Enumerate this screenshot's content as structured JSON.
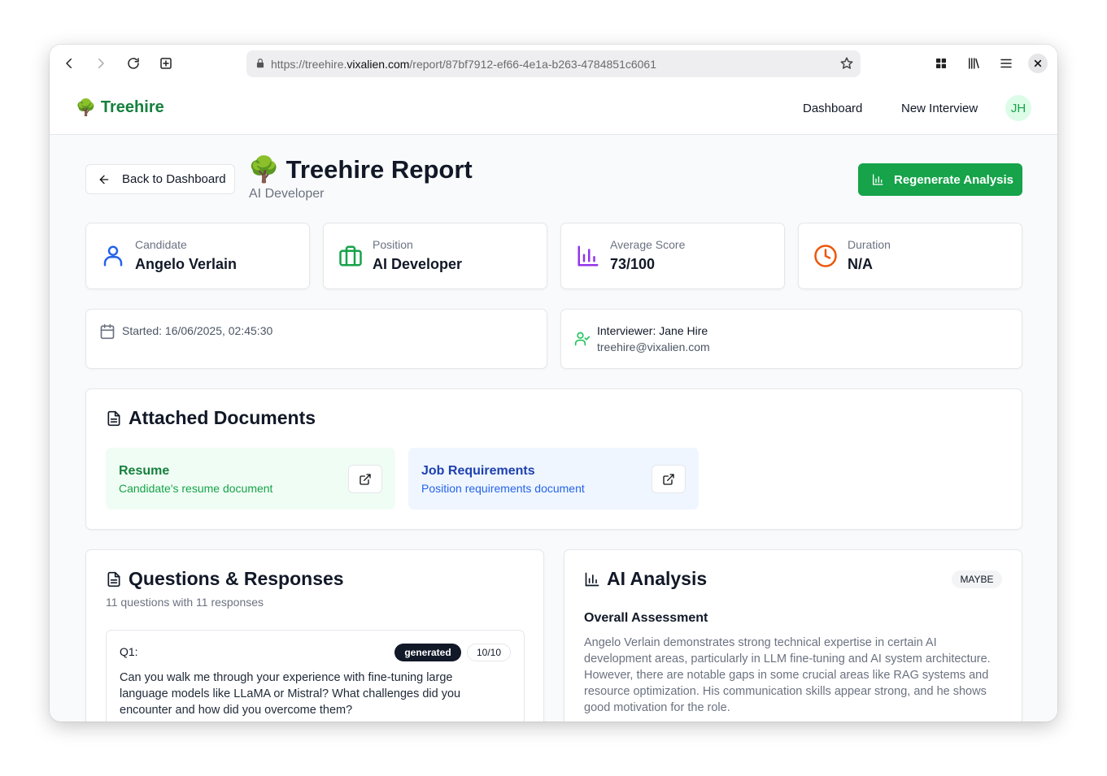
{
  "browser": {
    "url_prefix": "https://treehire.",
    "url_domain": "vixalien.com",
    "url_path": "/report/87bf7912-ef66-4e1a-b263-4784851c6061"
  },
  "nav": {
    "brand": "Treehire",
    "brand_icon": "🌳",
    "links": [
      "Dashboard",
      "New Interview"
    ],
    "avatar": "JH"
  },
  "header": {
    "back_label": "Back to Dashboard",
    "title_icon": "🌳",
    "title": "Treehire Report",
    "subtitle": "AI Developer",
    "regen_label": "Regenerate Analysis"
  },
  "stats": [
    {
      "label": "Candidate",
      "value": "Angelo Verlain",
      "icon": "user-icon",
      "color": "#2563eb"
    },
    {
      "label": "Position",
      "value": "AI Developer",
      "icon": "briefcase-icon",
      "color": "#16a34a"
    },
    {
      "label": "Average Score",
      "value": "73/100",
      "icon": "bar-chart-icon",
      "color": "#9333ea"
    },
    {
      "label": "Duration",
      "value": "N/A",
      "icon": "clock-icon",
      "color": "#ea580c"
    }
  ],
  "started": "Started: 16/06/2025, 02:45:30",
  "interviewer": {
    "name": "Interviewer: Jane Hire",
    "email": "treehire@vixalien.com"
  },
  "documents": {
    "title": "Attached Documents",
    "items": [
      {
        "title": "Resume",
        "subtitle": "Candidate's resume document"
      },
      {
        "title": "Job Requirements",
        "subtitle": "Position requirements document"
      }
    ]
  },
  "questions": {
    "title": "Questions & Responses",
    "summary": "11 questions with 11 responses",
    "items": [
      {
        "label": "Q1:",
        "tag": "generated",
        "score": "10/10",
        "text": "Can you walk me through your experience with fine-tuning large language models like LLaMA or Mistral? What challenges did you encounter and how did you overcome them?"
      }
    ]
  },
  "analysis": {
    "title": "AI Analysis",
    "verdict": "MAYBE",
    "overall_title": "Overall Assessment",
    "overall_text": "Angelo Verlain demonstrates strong technical expertise in certain AI development areas, particularly in LLM fine-tuning and AI system architecture. However, there are notable gaps in some crucial areas like RAG systems and resource optimization. His communication skills appear strong, and he shows good motivation for the role."
  },
  "colors": {
    "brand_green": "#15803d",
    "button_green": "#16a34a",
    "resume_bg": "#f0fdf4",
    "jobreq_bg": "#eff6ff"
  }
}
